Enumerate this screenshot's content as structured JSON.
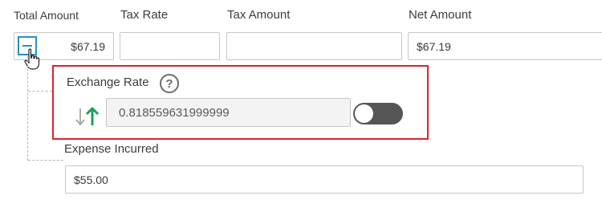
{
  "labels": {
    "total_amount": "Total Amount",
    "tax_rate": "Tax Rate",
    "tax_amount": "Tax Amount",
    "net_amount": "Net Amount",
    "exchange_rate": "Exchange Rate",
    "expense_incurred": "Expense Incurred"
  },
  "fields": {
    "total_amount": "$67.19",
    "tax_rate": "",
    "tax_amount": "",
    "net_amount": "$67.19",
    "exchange_rate": "0.818559631999999",
    "expense_incurred": "$55.00"
  },
  "help_icon_glyph": "?",
  "toggle": {
    "state": "off"
  },
  "colors": {
    "highlight": "#e0222c",
    "collapse_button": "#2b8fbf",
    "swap_up_arrow": "#1f9e5a",
    "swap_down_arrow": "#9a9a9a",
    "toggle_track": "#555555"
  },
  "icons": {
    "collapse": "minus-square-icon",
    "help": "question-circle-icon",
    "swap": "swap-arrows-icon",
    "cursor": "hand-pointer-icon"
  }
}
